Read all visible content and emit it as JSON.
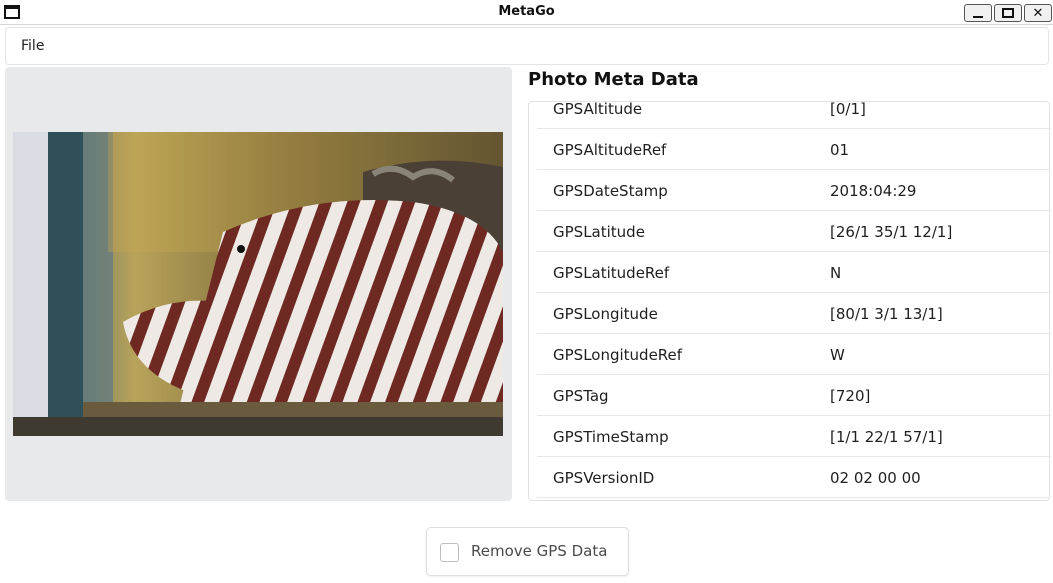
{
  "window": {
    "title": "MetaGo"
  },
  "menu": {
    "file_label": "File"
  },
  "meta": {
    "title": "Photo Meta Data",
    "rows": [
      {
        "key": "GPSAltitude",
        "value": "[0/1]"
      },
      {
        "key": "GPSAltitudeRef",
        "value": "01"
      },
      {
        "key": "GPSDateStamp",
        "value": "2018:04:29"
      },
      {
        "key": "GPSLatitude",
        "value": "[26/1 35/1 12/1]"
      },
      {
        "key": "GPSLatitudeRef",
        "value": "N"
      },
      {
        "key": "GPSLongitude",
        "value": "[80/1 3/1 13/1]"
      },
      {
        "key": "GPSLongitudeRef",
        "value": "W"
      },
      {
        "key": "GPSTag",
        "value": "[720]"
      },
      {
        "key": "GPSTimeStamp",
        "value": "[1/1 22/1 57/1]"
      },
      {
        "key": "GPSVersionID",
        "value": "02 02 00 00"
      }
    ]
  },
  "gps": {
    "remove_label": "Remove GPS Data",
    "checked": false
  }
}
